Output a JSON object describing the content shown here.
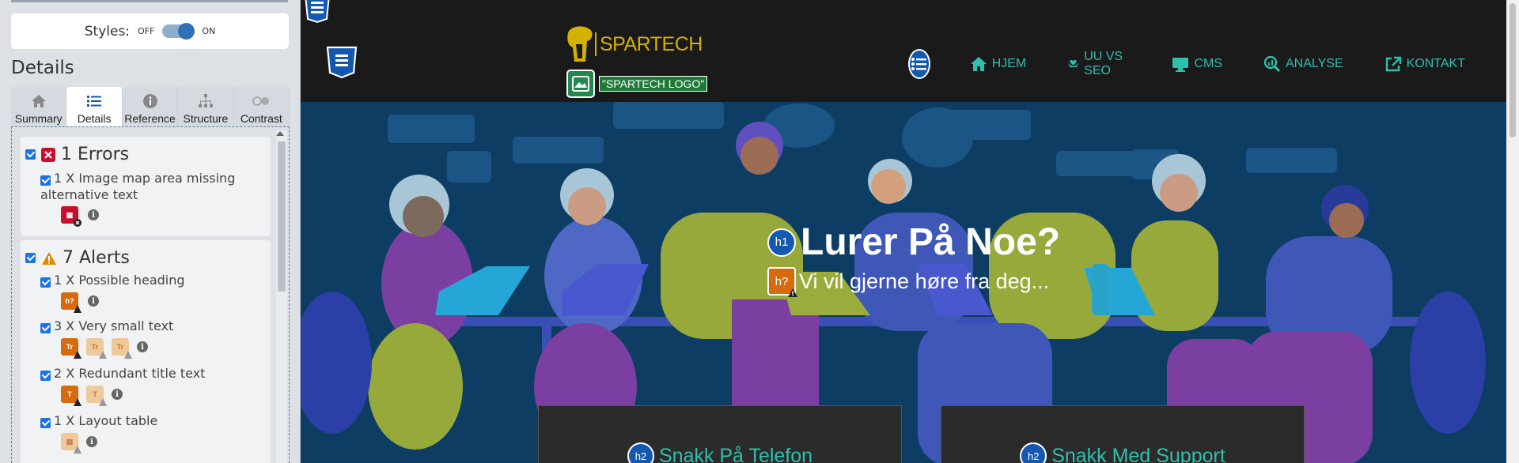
{
  "sidebar": {
    "styles_label": "Styles:",
    "toggle_off": "OFF",
    "toggle_on": "ON",
    "details_title": "Details",
    "tabs": [
      {
        "label": "Summary",
        "icon": "home-icon"
      },
      {
        "label": "Details",
        "icon": "list-icon"
      },
      {
        "label": "Reference",
        "icon": "info-icon"
      },
      {
        "label": "Structure",
        "icon": "sitemap-icon"
      },
      {
        "label": "Contrast",
        "icon": "contrast-icon"
      }
    ],
    "errors": {
      "title": "1 Errors",
      "items": [
        {
          "label": "1 X Image map area missing alternative text"
        }
      ]
    },
    "alerts": {
      "title": "7 Alerts",
      "items": [
        {
          "label": "1 X Possible heading"
        },
        {
          "label": "3 X Very small text"
        },
        {
          "label": "2 X Redundant title text"
        },
        {
          "label": "1 X Layout table"
        }
      ]
    },
    "colors": {
      "error": "#c8102e",
      "alert": "#d96a0c",
      "accent": "#1a73e8"
    }
  },
  "site": {
    "logo_text": "SPARTECH",
    "logo_alt": "\"SPARTECH LOGO\"",
    "nav": [
      {
        "label": "HJEM",
        "icon": "home-icon"
      },
      {
        "label": "UU VS SEO",
        "icon": "hands-heart-icon"
      },
      {
        "label": "CMS",
        "icon": "desktop-icon"
      },
      {
        "label": "ANALYSE",
        "icon": "search-chart-icon"
      },
      {
        "label": "KONTAKT",
        "icon": "external-link-icon"
      }
    ],
    "hero_badge_h1": "h1",
    "hero_title": "Lurer På Noe?",
    "hero_badge_hq": "h?",
    "hero_subtitle": "Vi vil gjerne høre fra deg...",
    "cards": [
      {
        "badge": "h2",
        "title": "Snakk På Telefon"
      },
      {
        "badge": "h2",
        "title": "Snakk Med Support"
      }
    ],
    "colors": {
      "teal": "#2fbfae",
      "logo": "#d4b000",
      "header": "#1a1a1a",
      "hero_bg": "#0d3d62"
    }
  }
}
